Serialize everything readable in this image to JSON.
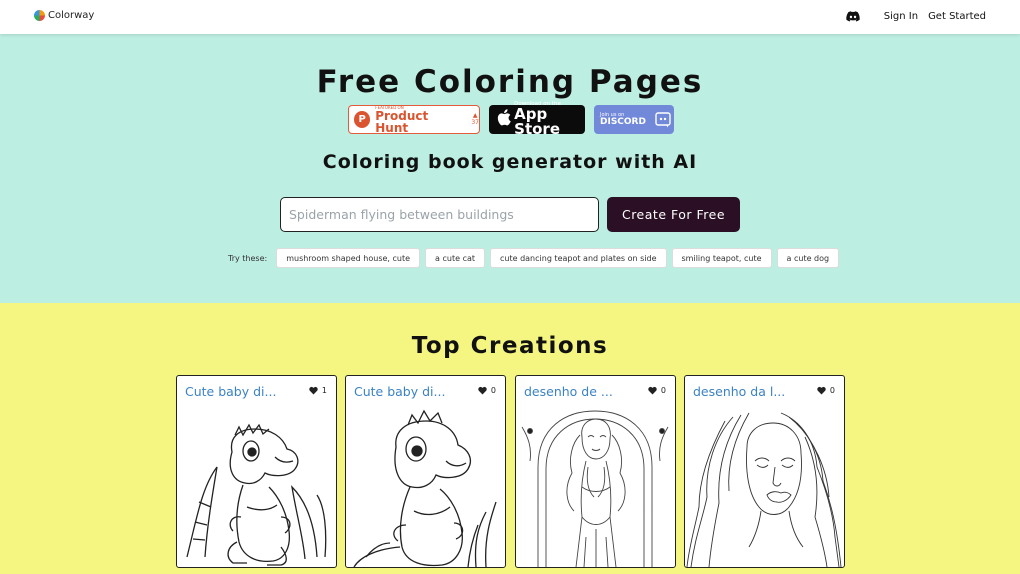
{
  "nav": {
    "brand": "Colorway",
    "links": [
      "Sign In",
      "Get Started"
    ]
  },
  "hero": {
    "title": "Free Coloring Pages",
    "badges": {
      "product_hunt": {
        "small": "FEATURED ON",
        "big": "Product Hunt",
        "votes": "37"
      },
      "app_store": {
        "small": "Download on the",
        "big": "App Store"
      },
      "discord": {
        "small": "Join us on",
        "big": "DISCORD"
      }
    },
    "subtitle": "Coloring book generator with AI",
    "search": {
      "placeholder": "Spiderman flying between buildings",
      "value": ""
    },
    "create_label": "Create For Free",
    "try_label": "Try these:",
    "suggestions": [
      "mushroom shaped house, cute",
      "a cute cat",
      "cute dancing teapot and plates on side",
      "smiling teapot, cute",
      "a cute dog"
    ]
  },
  "creations": {
    "title": "Top Creations",
    "cards": [
      {
        "title": "Cute baby di...",
        "likes": "1"
      },
      {
        "title": "Cute baby di...",
        "likes": "0"
      },
      {
        "title": "desenho de ...",
        "likes": "0"
      },
      {
        "title": "desenho da l...",
        "likes": "0"
      }
    ]
  },
  "colors": {
    "hero_bg": "#bdeee2",
    "creations_bg": "#f4f681",
    "button_bg": "#2b0f24",
    "card_title": "#3b82c4"
  }
}
